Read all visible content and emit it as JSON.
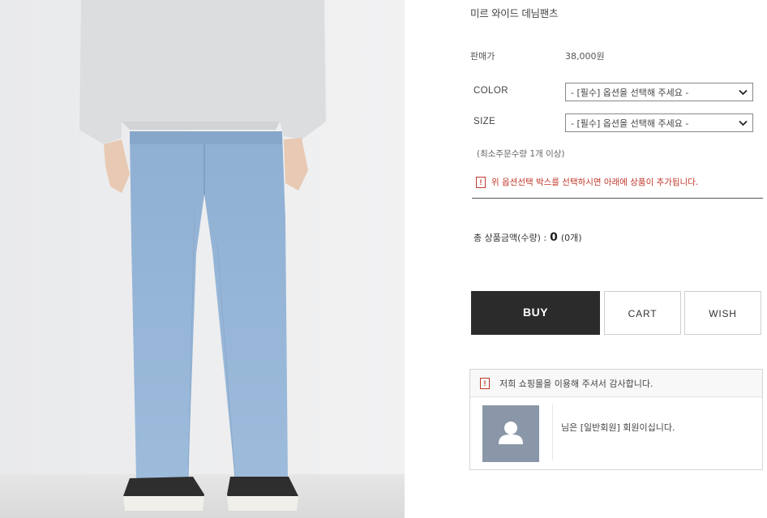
{
  "product": {
    "title": "미르 와이드 데님팬츠",
    "price_label": "판매가",
    "price_value": "38,000원"
  },
  "options": [
    {
      "label": "COLOR",
      "selected": "- [필수] 옵션을 선택해 주세요 -"
    },
    {
      "label": "SIZE",
      "selected": "- [필수] 옵션을 선택해 주세요 -"
    }
  ],
  "min_order_note": "(최소주문수량 1개 이상)",
  "warning": {
    "icon": "!",
    "text": "위 옵션선택 박스를 선택하시면 아래에 상품이 추가됩니다."
  },
  "total": {
    "label": "총 상품금액(수량) :",
    "amount": "0",
    "qty": "(0개)"
  },
  "buttons": {
    "buy": "BUY",
    "cart": "CART",
    "wish": "WISH"
  },
  "member": {
    "notice_icon": "!",
    "notice": "저희 쇼핑몰을 이용해 주셔서 감사합니다.",
    "greeting": "님은 [일반회원] 회원이십니다."
  },
  "icons": {
    "select_arrow": "chevron-down-icon",
    "avatar": "user-silhouette-icon"
  },
  "colors": {
    "buy_button": "#2b2b2b",
    "warning": "#c0392b",
    "avatar_bg": "#8a97a8"
  }
}
